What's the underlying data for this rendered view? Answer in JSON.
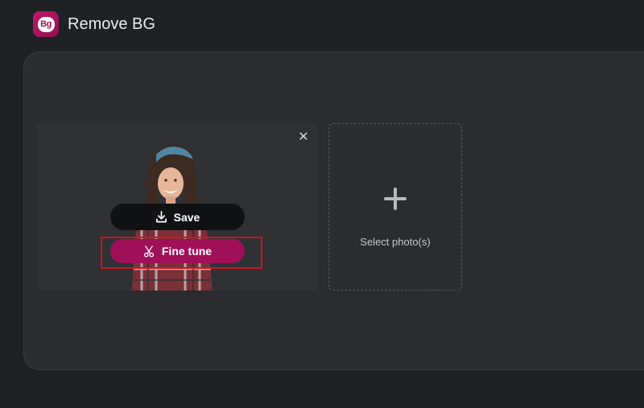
{
  "app": {
    "logo_text": "Bg",
    "title": "Remove BG"
  },
  "photo_card": {
    "close_symbol": "✕",
    "save_label": "Save",
    "fine_tune_label": "Fine tune"
  },
  "uploader": {
    "label": "Select photo(s)"
  },
  "icons": {
    "close": "close-icon",
    "save": "download-icon",
    "fine_tune": "scissors-icon",
    "add": "plus-icon"
  },
  "colors": {
    "background": "#202124",
    "panel": "#2a2c30",
    "brand": "#a0105a",
    "highlight": "#d3141a",
    "save_button": "#111214"
  }
}
